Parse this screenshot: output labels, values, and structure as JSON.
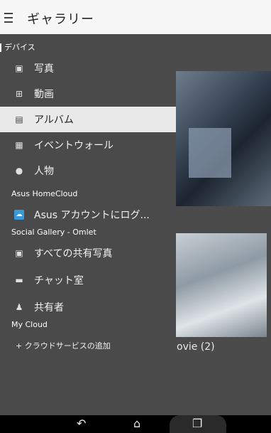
{
  "header": {
    "title": "ギャラリー"
  },
  "drawer": {
    "sections": {
      "device": "デバイス",
      "homecloud": "Asus HomeCloud",
      "social": "Social Gallery - Omlet",
      "mycloud": "My Cloud"
    },
    "items": [
      {
        "label": "写真",
        "icon": "photo-icon"
      },
      {
        "label": "動画",
        "icon": "video-icon"
      },
      {
        "label": "アルバム",
        "icon": "album-icon",
        "selected": true
      },
      {
        "label": "イベントウォール",
        "icon": "event-wall-icon"
      },
      {
        "label": "人物",
        "icon": "people-icon"
      },
      {
        "label": "Asus アカウントにログ...",
        "icon": "asus-cloud-icon"
      },
      {
        "label": "すべての共有写真",
        "icon": "shared-photos-icon"
      },
      {
        "label": "チャット室",
        "icon": "chat-icon"
      },
      {
        "label": "共有者",
        "icon": "sharer-icon"
      }
    ],
    "add_cloud": "+ クラウドサービスの追加"
  },
  "background": {
    "caption": "ovie (2)"
  },
  "navbar": {
    "back": "back-icon",
    "home": "home-icon",
    "recent": "recent-apps-icon"
  }
}
